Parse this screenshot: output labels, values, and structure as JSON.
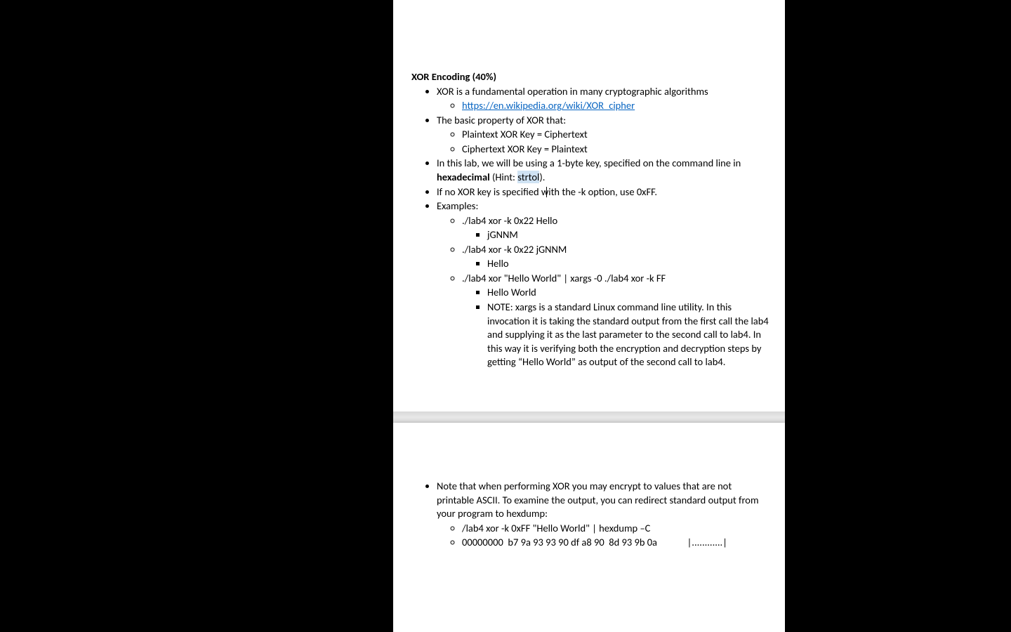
{
  "heading": "XOR Encoding (40%)",
  "b1": "XOR is a fundamental operation in many cryptographic algorithms",
  "link": "https://en.wikipedia.org/wiki/XOR_cipher",
  "b2": "The basic property of XOR that:",
  "b2a": "Plaintext XOR Key = Ciphertext",
  "b2b": "Ciphertext XOR Key = Plaintext",
  "b3_pre": "In this lab, we will be using a 1-byte key, specified on the command line in ",
  "b3_bold": "hexadecimal",
  "b3_after": " (Hint: ",
  "b3_hl": "strtol",
  "b3_tail": ").",
  "b4": "If no XOR key is specified with the -k option, use 0xFF.",
  "b5": "Examples:",
  "ex1": "./lab4 xor -k 0x22 Hello",
  "ex1o": "jGNNM",
  "ex2": "./lab4 xor -k 0x22 jGNNM",
  "ex2o": "Hello",
  "ex3": "./lab4 xor \"Hello World\" | xargs -0 ./lab4 xor -k FF",
  "ex3o1": "Hello World",
  "ex3o2": "NOTE: xargs is a standard Linux command line utility. In this invocation it is taking the standard output from the first call the lab4 and supplying it as the last parameter to the second call to lab4. In this way it is verifying both the encryption and decryption steps by getting “Hello World” as output of the second call to lab4.",
  "p2b1": "Note that when performing XOR you may encrypt to values that are not printable ASCII. To examine the output, you can redirect standard output from your program to hexdump:",
  "p2ex1": "/lab4 xor -k 0xFF \"Hello World\" | hexdump –C",
  "p2ex2": "00000000  b7 9a 93 93 90 df a8 90  8d 93 9b 0a             |............|"
}
